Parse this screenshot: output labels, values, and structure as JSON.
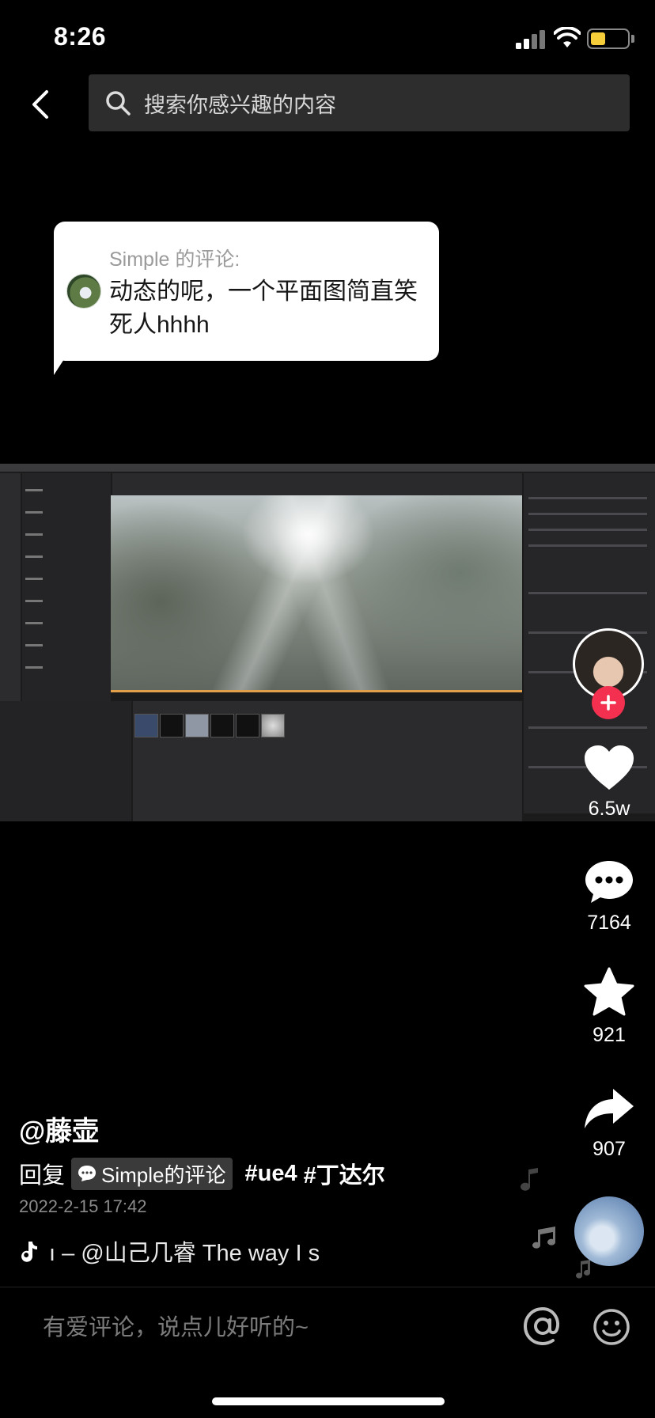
{
  "status_bar": {
    "time": "8:26",
    "battery_level": 0.35
  },
  "search": {
    "placeholder": "搜索你感兴趣的内容"
  },
  "comment_bubble": {
    "title": "Simple 的评论:",
    "body": "动态的呢，一个平面图简直笑死人hhhh"
  },
  "actions": {
    "likes": "6.5w",
    "comments": "7164",
    "favorites": "921",
    "shares": "907"
  },
  "post": {
    "author": "@藤壶",
    "reply_prefix": "回复",
    "reply_chip": "Simple的评论",
    "hashtags": [
      "#ue4",
      "#丁达尔"
    ],
    "date": "2022-2-15 17:42",
    "music": "ı – @山己几睿    The way I s"
  },
  "comment_bar": {
    "placeholder": "有爱评论，说点儿好听的~"
  },
  "colors": {
    "accent_red": "#f3304f",
    "background": "#000000",
    "search_bg": "#2d2d2d"
  },
  "icons": [
    "back-icon",
    "search-icon",
    "heart-icon",
    "comment-icon",
    "star-icon",
    "share-icon",
    "music-icon",
    "at-icon",
    "emoji-icon",
    "plus-icon"
  ]
}
